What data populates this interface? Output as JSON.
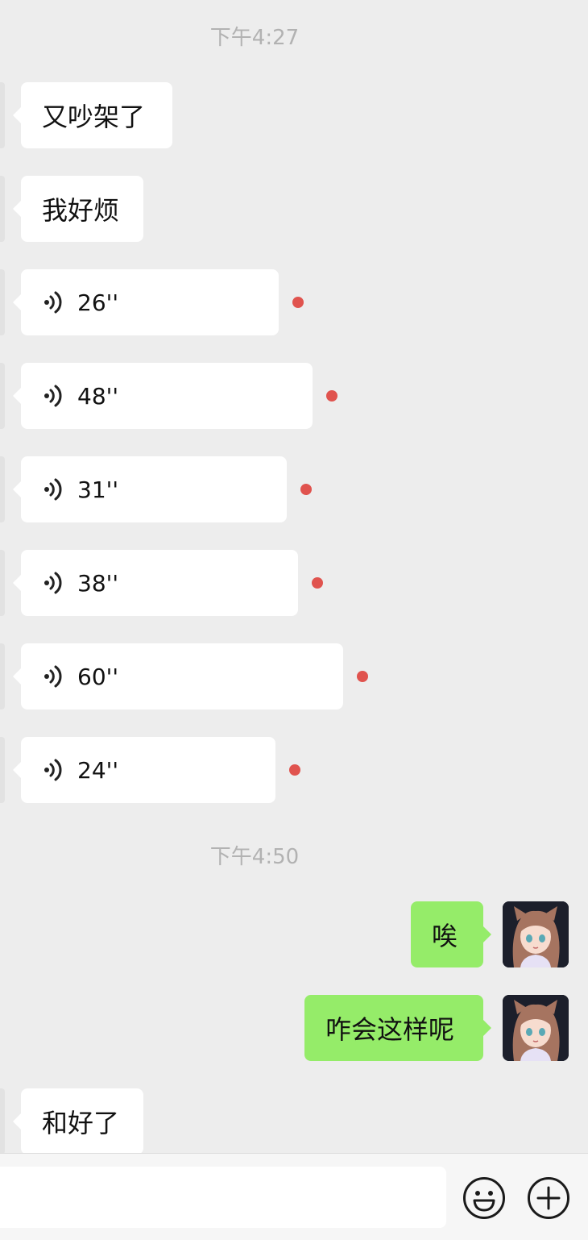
{
  "timestamps": [
    "下午4:27",
    "下午4:50"
  ],
  "messages": {
    "m1": "又吵架了",
    "m2": "我好烦",
    "v1": "26''",
    "v2": "48''",
    "v3": "31''",
    "v4": "38''",
    "v5": "60''",
    "v6": "24''",
    "s1": "唉",
    "s2": "咋会这样呢",
    "m3": "和好了"
  },
  "icons": {
    "voice": "voice-wave-icon",
    "emoji": "emoji-icon",
    "plus": "plus-icon",
    "unread": "unread-dot"
  },
  "colors": {
    "background": "#ededed",
    "incoming_bubble": "#ffffff",
    "outgoing_bubble": "#95ec69",
    "unread_dot": "#e0534e",
    "timestamp": "#b2b2b2"
  }
}
